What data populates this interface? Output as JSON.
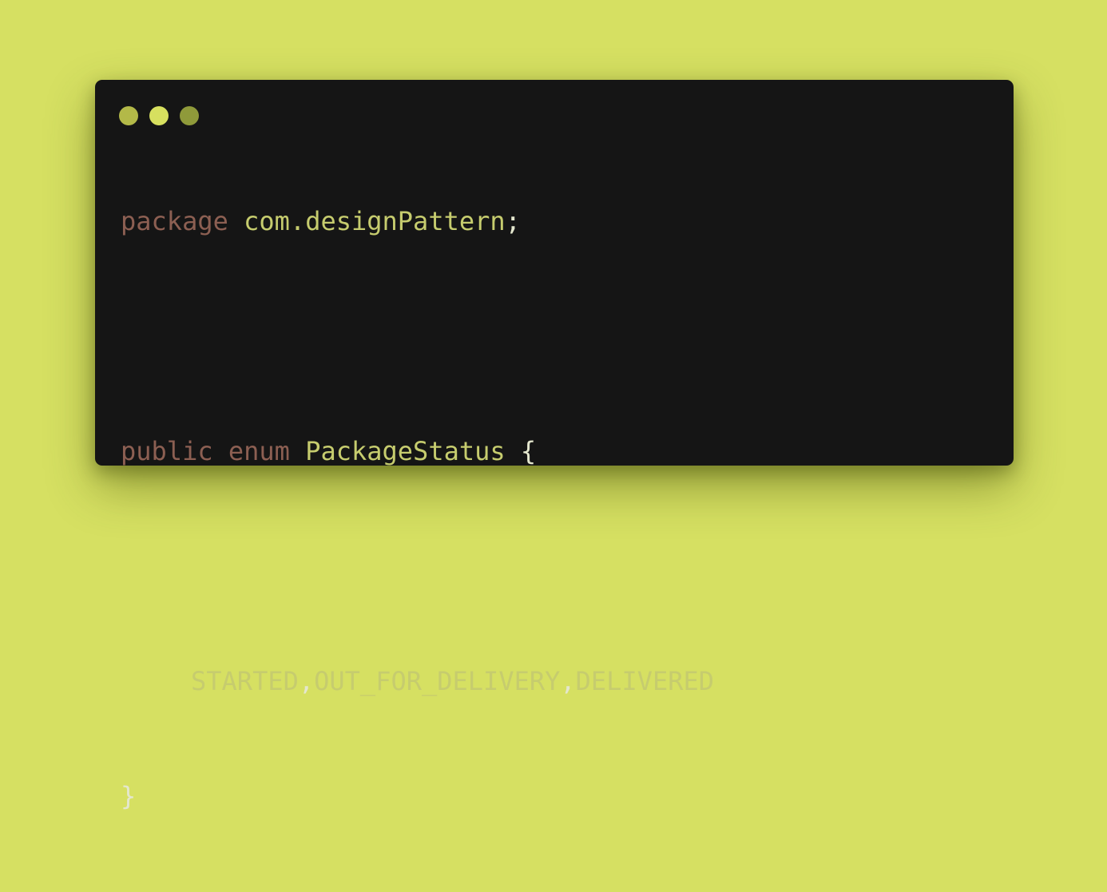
{
  "window": {
    "controls": [
      {
        "name": "close",
        "color": "#b3b948"
      },
      {
        "name": "minimize",
        "color": "#d7e05f"
      },
      {
        "name": "maximize",
        "color": "#8f9a3a"
      }
    ]
  },
  "code": {
    "lines": [
      {
        "tokens": [
          {
            "text": "package",
            "role": "keyword"
          },
          {
            "text": " ",
            "role": "space"
          },
          {
            "text": "com.designPattern",
            "role": "identifier"
          },
          {
            "text": ";",
            "role": "punctuation"
          }
        ]
      },
      {
        "tokens": []
      },
      {
        "tokens": [
          {
            "text": "public",
            "role": "keyword"
          },
          {
            "text": " ",
            "role": "space"
          },
          {
            "text": "enum",
            "role": "keyword"
          },
          {
            "text": " ",
            "role": "space"
          },
          {
            "text": "PackageStatus",
            "role": "type"
          },
          {
            "text": " ",
            "role": "space"
          },
          {
            "text": "{",
            "role": "brace"
          }
        ]
      },
      {
        "tokens": []
      },
      {
        "indent": true,
        "tokens": [
          {
            "text": "STARTED",
            "role": "constant"
          },
          {
            "text": ",",
            "role": "punctuation"
          },
          {
            "text": "OUT_FOR_DELIVERY",
            "role": "constant"
          },
          {
            "text": ",",
            "role": "punctuation"
          },
          {
            "text": "DELIVERED",
            "role": "constant"
          }
        ]
      },
      {
        "tokens": [
          {
            "text": "}",
            "role": "brace"
          }
        ]
      }
    ]
  },
  "colors": {
    "background": "#d6e062",
    "window": "#151515",
    "keyword": "#8c5f52",
    "identifier": "#c6cc6e",
    "type": "#c6cc6e",
    "constant": "#c6cc6e",
    "punctuation": "#e4e7ce",
    "brace": "#e4e7ce",
    "space": "#c6cc6e"
  }
}
